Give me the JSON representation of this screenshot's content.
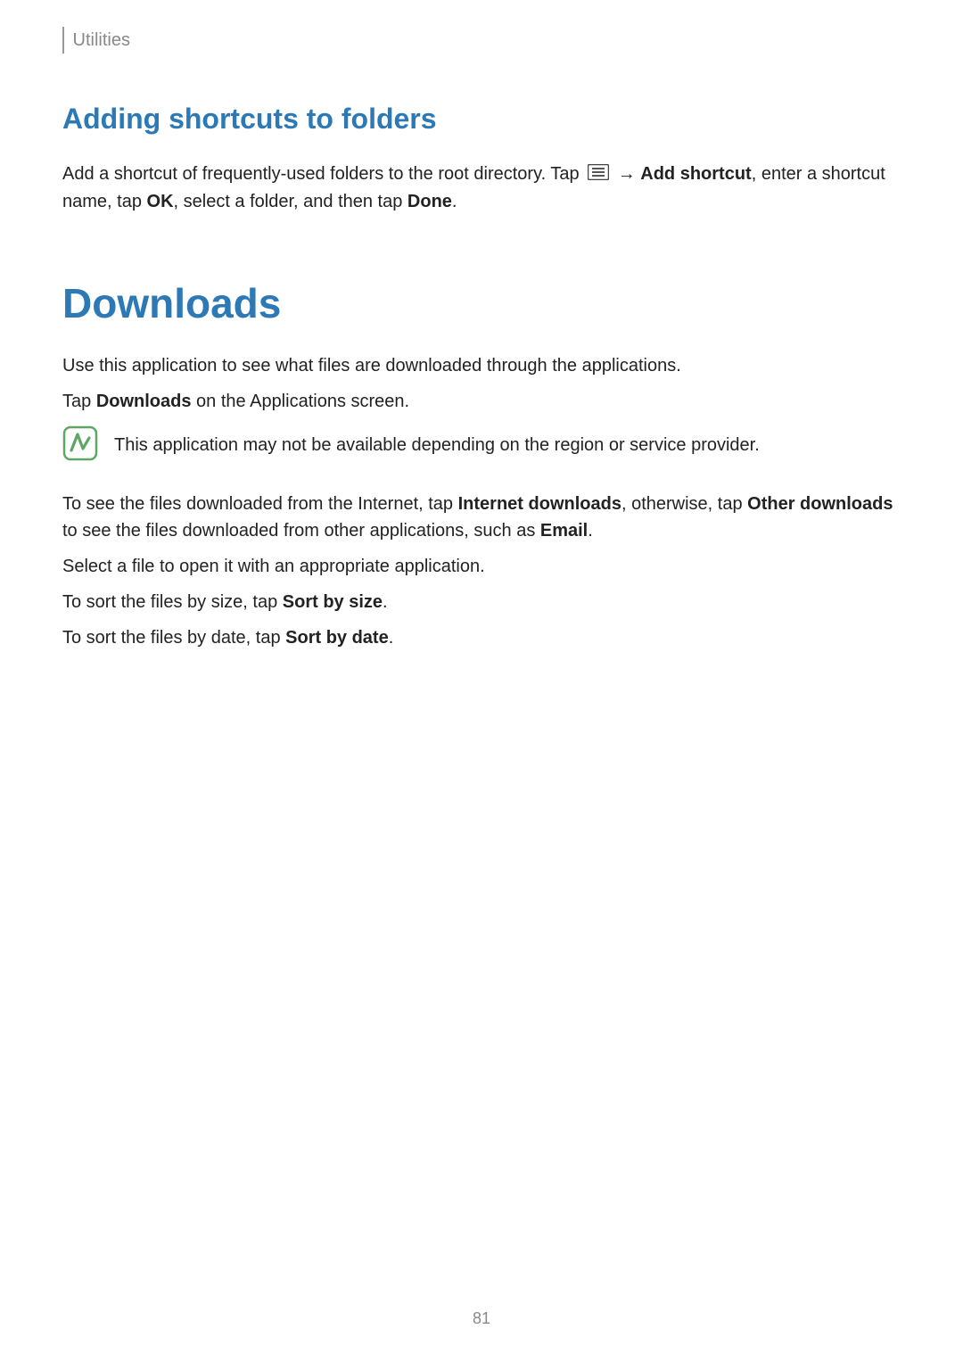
{
  "header": {
    "section": "Utilities"
  },
  "section1": {
    "title": "Adding shortcuts to folders",
    "p1a": "Add a shortcut of frequently-used folders to the root directory. Tap ",
    "p1b": " → ",
    "p1c": "Add shortcut",
    "p1d": ", enter a shortcut name, tap ",
    "p1e": "OK",
    "p1f": ", select a folder, and then tap ",
    "p1g": "Done",
    "p1h": "."
  },
  "section2": {
    "title": "Downloads",
    "p1": "Use this application to see what files are downloaded through the applications.",
    "p2a": "Tap ",
    "p2b": "Downloads",
    "p2c": " on the Applications screen.",
    "note": "This application may not be available depending on the region or service provider.",
    "p3a": "To see the files downloaded from the Internet, tap ",
    "p3b": "Internet downloads",
    "p3c": ", otherwise, tap ",
    "p3d": "Other downloads",
    "p3e": " to see the files downloaded from other applications, such as ",
    "p3f": "Email",
    "p3g": ".",
    "p4": "Select a file to open it with an appropriate application.",
    "p5a": "To sort the files by size, tap ",
    "p5b": "Sort by size",
    "p5c": ".",
    "p6a": "To sort the files by date, tap ",
    "p6b": "Sort by date",
    "p6c": "."
  },
  "pageNumber": "81"
}
